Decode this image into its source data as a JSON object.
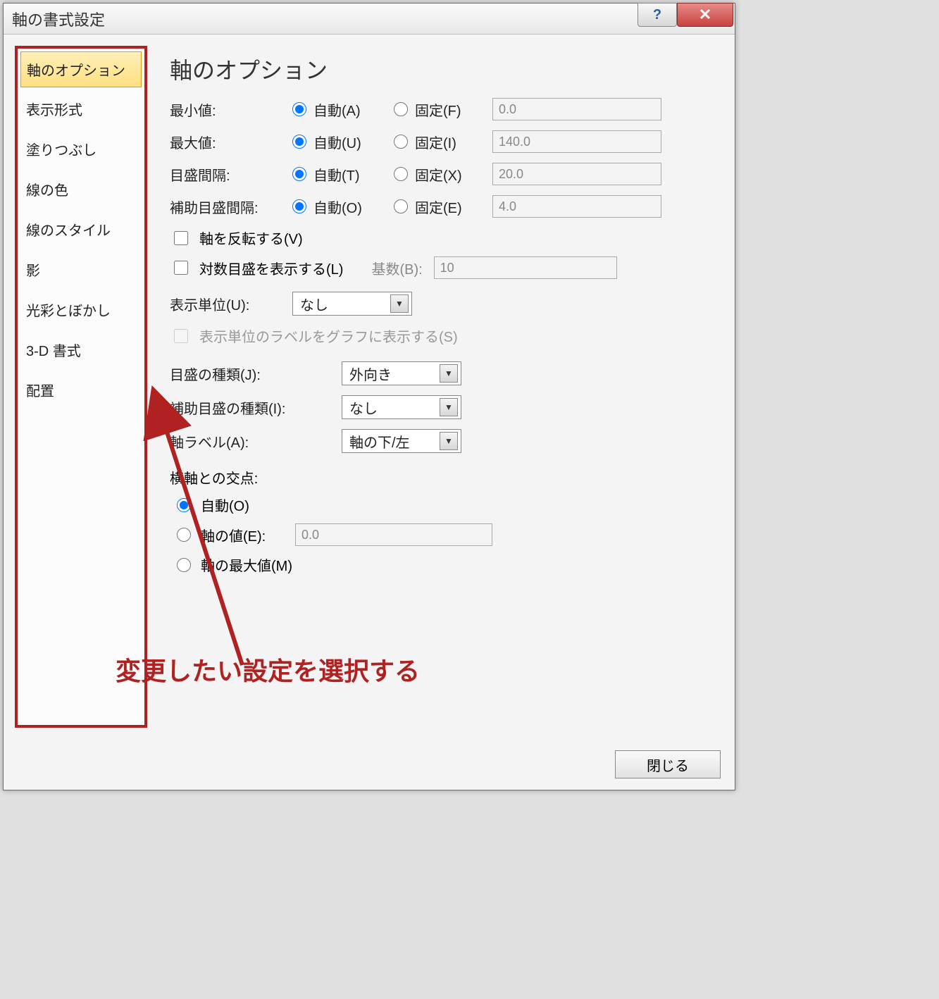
{
  "titlebar": {
    "title": "軸の書式設定",
    "help_glyph": "?",
    "close_glyph": "✕"
  },
  "sidebar": {
    "items": [
      {
        "label": "軸のオプション",
        "selected": true
      },
      {
        "label": "表示形式"
      },
      {
        "label": "塗りつぶし"
      },
      {
        "label": "線の色"
      },
      {
        "label": "線のスタイル"
      },
      {
        "label": "影"
      },
      {
        "label": "光彩とぼかし"
      },
      {
        "label": "3-D 書式"
      },
      {
        "label": "配置"
      }
    ]
  },
  "panel": {
    "heading": "軸のオプション",
    "rows": [
      {
        "label": "最小値:",
        "auto_label": "自動(A)",
        "fixed_label": "固定(F)",
        "value": "0.0"
      },
      {
        "label": "最大値:",
        "auto_label": "自動(U)",
        "fixed_label": "固定(I)",
        "value": "140.0"
      },
      {
        "label": "目盛間隔:",
        "auto_label": "自動(T)",
        "fixed_label": "固定(X)",
        "value": "20.0"
      },
      {
        "label": "補助目盛間隔:",
        "auto_label": "自動(O)",
        "fixed_label": "固定(E)",
        "value": "4.0"
      }
    ],
    "checks": {
      "reverse": "軸を反転する(V)",
      "log": "対数目盛を表示する(L)",
      "log_base_label": "基数(B):",
      "log_base_value": "10"
    },
    "display_unit": {
      "label": "表示単位(U):",
      "value": "なし",
      "show_label_on_chart": "表示単位のラベルをグラフに表示する(S)"
    },
    "tick_major": {
      "label": "目盛の種類(J):",
      "value": "外向き"
    },
    "tick_minor": {
      "label": "補助目盛の種類(I):",
      "value": "なし"
    },
    "axis_labels": {
      "label": "軸ラベル(A):",
      "value": "軸の下/左"
    },
    "cross": {
      "heading": "横軸との交点:",
      "auto": "自動(O)",
      "value_label": "軸の値(E):",
      "value": "0.0",
      "max": "軸の最大値(M)"
    }
  },
  "footer": {
    "close_label": "閉じる"
  },
  "annotation": {
    "text": "変更したい設定を選択する"
  }
}
